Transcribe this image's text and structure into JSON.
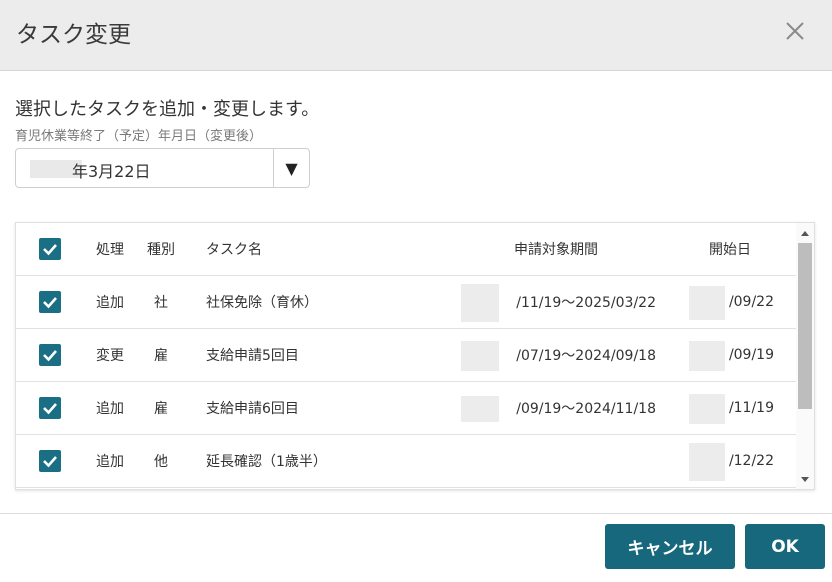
{
  "dialog": {
    "title": "タスク変更",
    "description": "選択したタスクを追加・変更します。"
  },
  "end_date_field": {
    "label": "育児休業等終了（予定）年月日（変更後）",
    "value": "年3月22日"
  },
  "table": {
    "headers": {
      "process": "処理",
      "kind": "種別",
      "task_name": "タスク名",
      "period": "申請対象期間",
      "start_date": "開始日"
    },
    "rows": [
      {
        "process": "追加",
        "kind": "社",
        "task_name": "社保免除（育休）",
        "period": "/11/19〜2025/03/22",
        "start_date": "/09/22"
      },
      {
        "process": "変更",
        "kind": "雇",
        "task_name": "支給申請5回目",
        "period": "/07/19〜2024/09/18",
        "start_date": "/09/19"
      },
      {
        "process": "追加",
        "kind": "雇",
        "task_name": "支給申請6回目",
        "period": "/09/19〜2024/11/18",
        "start_date": "/11/19"
      },
      {
        "process": "追加",
        "kind": "他",
        "task_name": "延長確認（1歳半）",
        "period": "",
        "start_date": "/12/22"
      }
    ]
  },
  "buttons": {
    "cancel": "キャンセル",
    "ok": "OK"
  },
  "icons": {
    "close": "close-icon",
    "dropdown": "triangle-down-icon",
    "checkbox": "checkmark-icon"
  },
  "colors": {
    "accent": "#17687c",
    "checkbox": "#1a6f85",
    "header_bg": "#ececec"
  }
}
